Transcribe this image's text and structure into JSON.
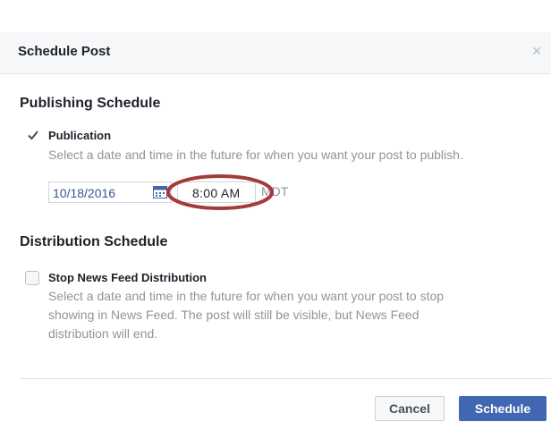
{
  "dialog": {
    "title": "Schedule Post",
    "close_label": "×"
  },
  "publishing": {
    "section_title": "Publishing Schedule",
    "option_label": "Publication",
    "option_checked": true,
    "description": "Select a date and time in the future for when you want your post to publish.",
    "date_value": "10/18/2016",
    "time_value": "8:00 AM",
    "timezone": "MDT"
  },
  "distribution": {
    "section_title": "Distribution Schedule",
    "option_label": "Stop News Feed Distribution",
    "option_checked": false,
    "description_lines": [
      "Select a date and time in the future for when you want your post to stop",
      "showing in News Feed. The post will still be visible, but News Feed",
      "distribution will end."
    ]
  },
  "footer": {
    "cancel_label": "Cancel",
    "schedule_label": "Schedule"
  },
  "colors": {
    "primary": "#4267b2",
    "link": "#385898",
    "annotation": "#a33b38"
  }
}
